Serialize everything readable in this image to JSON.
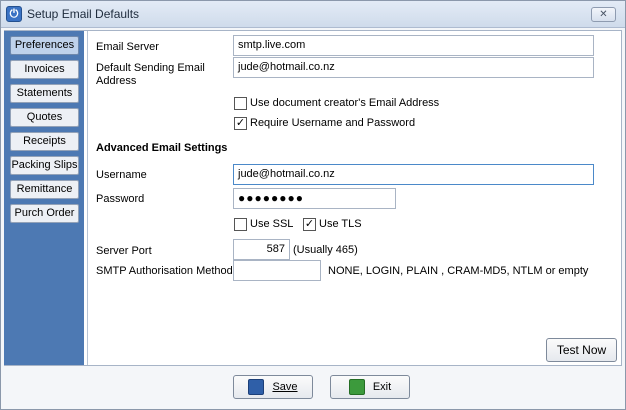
{
  "window": {
    "title": "Setup Email Defaults",
    "close_symbol": "✕"
  },
  "sidebar": {
    "items": [
      {
        "label": "Preferences",
        "active": true
      },
      {
        "label": "Invoices",
        "active": false
      },
      {
        "label": "Statements",
        "active": false
      },
      {
        "label": "Quotes",
        "active": false
      },
      {
        "label": "Receipts",
        "active": false
      },
      {
        "label": "Packing Slips",
        "active": false
      },
      {
        "label": "Remittance",
        "active": false
      },
      {
        "label": "Purch Order",
        "active": false
      }
    ]
  },
  "form": {
    "email_server": {
      "label": "Email Server",
      "value": "smtp.live.com"
    },
    "default_sending": {
      "label_line1": "Default Sending Email",
      "label_line2": "Address",
      "value": "jude@hotmail.co.nz"
    },
    "use_creator_email": {
      "label": "Use document creator's Email Address",
      "checked": false
    },
    "require_auth": {
      "label": "Require Username and Password",
      "checked": true
    },
    "advanced_heading": "Advanced Email Settings",
    "username": {
      "label": "Username",
      "value": "jude@hotmail.co.nz"
    },
    "password": {
      "label": "Password",
      "value": "●●●●●●●●"
    },
    "use_ssl": {
      "label": "Use SSL",
      "checked": false
    },
    "use_tls": {
      "label": "Use TLS",
      "checked": true
    },
    "server_port": {
      "label": "Server Port",
      "value": "587",
      "hint": "(Usually 465)"
    },
    "smtp_method": {
      "label": "SMTP Authorisation Method",
      "value": "",
      "hint": "NONE, LOGIN, PLAIN , CRAM-MD5, NTLM or empty"
    }
  },
  "buttons": {
    "test_now": "Test Now",
    "save": "Save",
    "exit": "Exit"
  },
  "colors": {
    "sidebar": "#4d79b3",
    "active_tab": "#bfd2eb"
  }
}
